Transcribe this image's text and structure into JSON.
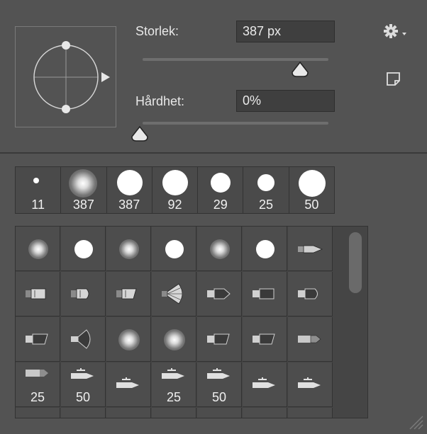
{
  "size": {
    "label": "Storlek:",
    "value": "387 px"
  },
  "hardness": {
    "label": "Hårdhet:",
    "value": "0%"
  },
  "recent_brushes": [
    "11",
    "387",
    "387",
    "92",
    "29",
    "25",
    "50"
  ],
  "grid_rows": [
    [
      "",
      "",
      "",
      "",
      "",
      "",
      ""
    ],
    [
      "",
      "",
      "",
      "",
      "",
      "",
      ""
    ],
    [
      "",
      "",
      "",
      "",
      "",
      "",
      ""
    ],
    [
      "25",
      "50",
      "",
      "25",
      "50",
      "",
      ""
    ]
  ],
  "icons": {
    "settings": "gear-icon",
    "new_preset": "new-document-icon",
    "resize": "resize-grip-icon"
  },
  "colors": {
    "panel": "#535353",
    "field": "#3f3f3f"
  }
}
